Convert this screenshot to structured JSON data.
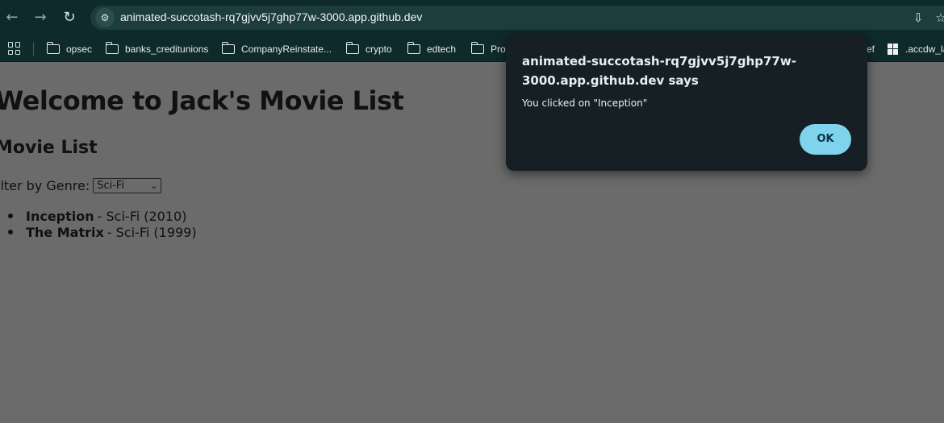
{
  "browser": {
    "url": "animated-succotash-rq7gjvv5j7ghp77w-3000.app.github.dev",
    "nav": {
      "back_icon": "←",
      "forward_icon": "→",
      "reload_icon": "↻"
    },
    "site_info_icon": "⚙",
    "install_icon": "⇩",
    "bookmark_star_icon": "☆"
  },
  "bookmarks": {
    "items": [
      {
        "label": "opsec"
      },
      {
        "label": "banks_creditunions"
      },
      {
        "label": "CompanyReinstate..."
      },
      {
        "label": "crypto"
      },
      {
        "label": "edtech"
      },
      {
        "label": "Pro"
      }
    ],
    "partial_right": "ef",
    "last_item": ".accdw_la"
  },
  "page": {
    "title": "Welcome to Jack's Movie List",
    "subtitle": "Movie List",
    "filter_label": "ilter by Genre:",
    "filter_selected": "Sci-Fi",
    "movies": [
      {
        "name": "Inception",
        "detail": "- Sci-Fi (2010)"
      },
      {
        "name": "The Matrix",
        "detail": "- Sci-Fi (1999)"
      }
    ]
  },
  "dialog": {
    "title": "animated-succotash-rq7gjvv5j7ghp77w-3000.app.github.dev says",
    "message": "You clicked on \"Inception\"",
    "ok_label": "OK"
  }
}
